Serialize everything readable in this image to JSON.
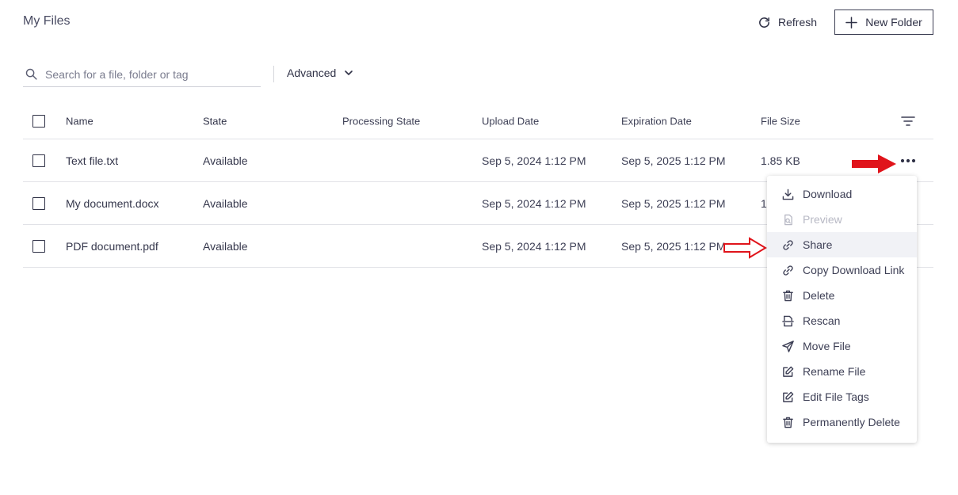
{
  "header": {
    "title": "My Files",
    "refresh_label": "Refresh",
    "new_folder_label": "New Folder"
  },
  "search": {
    "placeholder": "Search for a file, folder or tag",
    "value": ""
  },
  "advanced_label": "Advanced",
  "table": {
    "columns": [
      "Name",
      "State",
      "Processing State",
      "Upload Date",
      "Expiration Date",
      "File Size"
    ],
    "rows": [
      {
        "name": "Text file.txt",
        "state": "Available",
        "processing_state": "",
        "upload_date": "Sep 5, 2024 1:12 PM",
        "expiration_date": "Sep 5, 2025 1:12 PM",
        "file_size": "1.85 KB"
      },
      {
        "name": "My document.docx",
        "state": "Available",
        "processing_state": "",
        "upload_date": "Sep 5, 2024 1:12 PM",
        "expiration_date": "Sep 5, 2025 1:12 PM",
        "file_size": "1"
      },
      {
        "name": "PDF document.pdf",
        "state": "Available",
        "processing_state": "",
        "upload_date": "Sep 5, 2024 1:12 PM",
        "expiration_date": "Sep 5, 2025 1:12 PM",
        "file_size": ""
      }
    ]
  },
  "context_menu": {
    "items": [
      {
        "label": "Download",
        "icon": "download-icon",
        "disabled": false
      },
      {
        "label": "Preview",
        "icon": "preview-icon",
        "disabled": true
      },
      {
        "label": "Share",
        "icon": "link-icon",
        "disabled": false
      },
      {
        "label": "Copy Download Link",
        "icon": "link-icon",
        "disabled": false
      },
      {
        "label": "Delete",
        "icon": "trash-icon",
        "disabled": false
      },
      {
        "label": "Rescan",
        "icon": "scan-icon",
        "disabled": false
      },
      {
        "label": "Move File",
        "icon": "send-icon",
        "disabled": false
      },
      {
        "label": "Rename File",
        "icon": "edit-icon",
        "disabled": false
      },
      {
        "label": "Edit File Tags",
        "icon": "edit-icon",
        "disabled": false
      },
      {
        "label": "Permanently Delete",
        "icon": "trash-icon",
        "disabled": false
      }
    ]
  },
  "colors": {
    "text": "#3d3f55",
    "annotation_red": "#e0141b",
    "menu_highlight": "#f1f2f6"
  }
}
